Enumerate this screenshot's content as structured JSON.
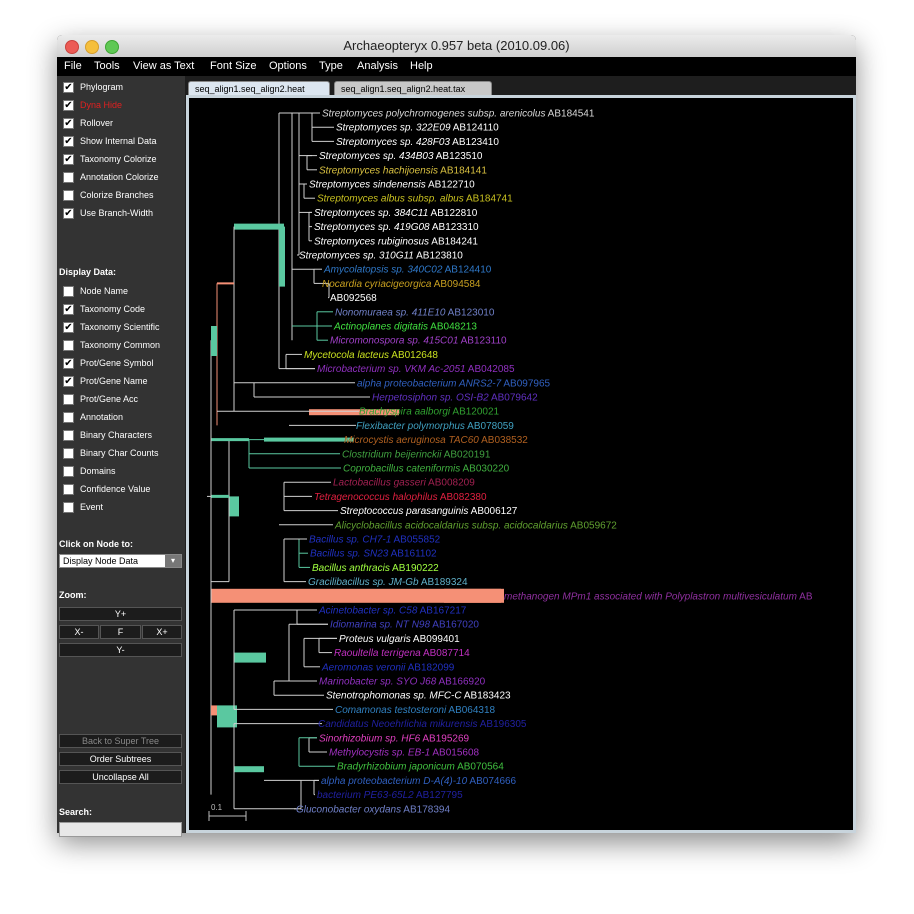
{
  "window": {
    "title": "Archaeopteryx 0.957 beta (2010.09.06)"
  },
  "menu": [
    "File",
    "Tools",
    "View as Text",
    "Font Size",
    "Options",
    "Type",
    "Analysis",
    "Help"
  ],
  "toggles": [
    {
      "label": "Phylogram",
      "checked": true,
      "color": "#ffffff"
    },
    {
      "label": "Dyna Hide",
      "checked": true,
      "color": "#e02020"
    },
    {
      "label": "Rollover",
      "checked": true,
      "color": "#ffffff"
    },
    {
      "label": "Show Internal Data",
      "checked": true,
      "color": "#ffffff"
    },
    {
      "label": "Taxonomy Colorize",
      "checked": true,
      "color": "#ffffff"
    },
    {
      "label": "Annotation Colorize",
      "checked": false,
      "color": "#ffffff"
    },
    {
      "label": "Colorize Branches",
      "checked": false,
      "color": "#ffffff"
    },
    {
      "label": "Use Branch-Width",
      "checked": true,
      "color": "#ffffff"
    }
  ],
  "display_data_header": "Display Data:",
  "display_data": [
    {
      "label": "Node Name",
      "checked": false
    },
    {
      "label": "Taxonomy Code",
      "checked": true
    },
    {
      "label": "Taxonomy Scientific",
      "checked": true
    },
    {
      "label": "Taxonomy Common",
      "checked": false
    },
    {
      "label": "Prot/Gene Symbol",
      "checked": true
    },
    {
      "label": "Prot/Gene Name",
      "checked": true
    },
    {
      "label": "Prot/Gene Acc",
      "checked": false
    },
    {
      "label": "Annotation",
      "checked": false
    },
    {
      "label": "Binary Characters",
      "checked": false
    },
    {
      "label": "Binary Char Counts",
      "checked": false
    },
    {
      "label": "Domains",
      "checked": false
    },
    {
      "label": "Confidence Value",
      "checked": false
    },
    {
      "label": "Event",
      "checked": false
    }
  ],
  "click_on_node": {
    "header": "Click on Node to:",
    "selected": "Display Node Data"
  },
  "zoom": {
    "header": "Zoom:",
    "y_plus": "Y+",
    "x_minus": "X-",
    "fit": "F",
    "x_plus": "X+",
    "y_minus": "Y-"
  },
  "buttons": {
    "back": "Back to Super Tree",
    "order": "Order Subtrees",
    "uncollapse": "Uncollapse All"
  },
  "search": {
    "header": "Search:",
    "value": ""
  },
  "tabs": [
    {
      "label": "seq_align1.seq_align2.heat",
      "active": true
    },
    {
      "label": "seq_align1.seq_align2.heat.tax",
      "active": false
    }
  ],
  "scale_label": "0.1",
  "leaves": [
    {
      "name": "Streptomyces polychromogenes subsp. arenicolus",
      "acc": "AB184541",
      "color": "#d8d8d8"
    },
    {
      "name": "Streptomyces sp. 322E09",
      "acc": "AB124110",
      "color": "#ffffff"
    },
    {
      "name": "Streptomyces sp. 428F03",
      "acc": "AB123410",
      "color": "#ffffff"
    },
    {
      "name": "Streptomyces sp. 434B03",
      "acc": "AB123510",
      "color": "#ffffff"
    },
    {
      "name": "Streptomyces hachijoensis",
      "acc": "AB184141",
      "color": "#d8c040"
    },
    {
      "name": "Streptomyces sindenensis",
      "acc": "AB122710",
      "color": "#ffffff"
    },
    {
      "name": "Streptomyces albus subsp. albus",
      "acc": "AB184741",
      "color": "#c8c020"
    },
    {
      "name": "Streptomyces sp. 384C11",
      "acc": "AB122810",
      "color": "#ffffff"
    },
    {
      "name": "Streptomyces sp. 419G08",
      "acc": "AB123310",
      "color": "#ffffff"
    },
    {
      "name": "Streptomyces rubiginosus",
      "acc": "AB184241",
      "color": "#ffffff"
    },
    {
      "name": "Streptomyces sp. 310G11",
      "acc": "AB123810",
      "color": "#ffffff"
    },
    {
      "name": "Amycolatopsis sp. 340C02",
      "acc": "AB124410",
      "color": "#2f78c8"
    },
    {
      "name": "Nocardia cyriacigeorgica",
      "acc": "AB094584",
      "color": "#c8a020"
    },
    {
      "name": "",
      "acc": "AB092568",
      "color": "#ffffff"
    },
    {
      "name": "Nonomuraea sp. 411E10",
      "acc": "AB123010",
      "color": "#7080c8"
    },
    {
      "name": "Actinoplanes digitatis",
      "acc": "AB048213",
      "color": "#40e040"
    },
    {
      "name": "Micromonospora sp. 415C01",
      "acc": "AB123110",
      "color": "#a040c8"
    },
    {
      "name": "Mycetocola lacteus",
      "acc": "AB012648",
      "color": "#c8e020"
    },
    {
      "name": "Microbacterium sp. VKM Ac-2051",
      "acc": "AB042085",
      "color": "#9030c0"
    },
    {
      "name": "alpha proteobacterium ANRS2-7",
      "acc": "AB097965",
      "color": "#3060c0"
    },
    {
      "name": "Herpetosiphon sp. OSI-B2",
      "acc": "AB079642",
      "color": "#6030c0"
    },
    {
      "name": "Brachyspira aalborgi",
      "acc": "AB120021",
      "color": "#30a030"
    },
    {
      "name": "Flexibacter polymorphus",
      "acc": "AB078059",
      "color": "#40a0c0"
    },
    {
      "name": "Microcystis aeruginosa TAC60",
      "acc": "AB038532",
      "color": "#b06020"
    },
    {
      "name": "Clostridium beijerinckii",
      "acc": "AB020191",
      "color": "#40a040"
    },
    {
      "name": "Coprobacillus cateniformis",
      "acc": "AB030220",
      "color": "#40b040"
    },
    {
      "name": "Lactobacillus gasseri",
      "acc": "AB008209",
      "color": "#a02050"
    },
    {
      "name": "Tetragenococcus halophilus",
      "acc": "AB082380",
      "color": "#e02040"
    },
    {
      "name": "Streptococcus parasanguinis",
      "acc": "AB006127",
      "color": "#ffffff"
    },
    {
      "name": "Alicyclobacillus acidocaldarius subsp. acidocaldarius",
      "acc": "AB059672",
      "color": "#60a030"
    },
    {
      "name": "Bacillus sp. CH7-1",
      "acc": "AB055852",
      "color": "#2030c0"
    },
    {
      "name": "Bacillus sp. SN23",
      "acc": "AB161102",
      "color": "#2030c0"
    },
    {
      "name": "Bacillus anthracis",
      "acc": "AB190222",
      "color": "#a0ff40"
    },
    {
      "name": "Gracilibacillus sp. JM-Gb",
      "acc": "AB189324",
      "color": "#60b0c8"
    },
    {
      "name": "methanogen MPm1 associated with Polyplastron multivesiculatum",
      "acc": "AB",
      "color": "#9030a0"
    },
    {
      "name": "Acinetobacter sp. C58",
      "acc": "AB167217",
      "color": "#2030c0"
    },
    {
      "name": "Idiomarina sp. NT N98",
      "acc": "AB167020",
      "color": "#4040c0"
    },
    {
      "name": "Proteus vulgaris",
      "acc": "AB099401",
      "color": "#ffffff"
    },
    {
      "name": "Raoultella terrigena",
      "acc": "AB087714",
      "color": "#c030c0"
    },
    {
      "name": "Aeromonas veronii",
      "acc": "AB182099",
      "color": "#2030c0"
    },
    {
      "name": "Marinobacter sp. SYO J68",
      "acc": "AB166920",
      "color": "#9030c0"
    },
    {
      "name": "Stenotrophomonas sp. MFC-C",
      "acc": "AB183423",
      "color": "#ffffff"
    },
    {
      "name": "Comamonas testosteroni",
      "acc": "AB064318",
      "color": "#3080c0"
    },
    {
      "name": "Candidatus Neoehrlichia mikurensis",
      "acc": "AB196305",
      "color": "#2020a0"
    },
    {
      "name": "Sinorhizobium sp. HF6",
      "acc": "AB195269",
      "color": "#e040c0"
    },
    {
      "name": "Methylocystis sp. EB-1",
      "acc": "AB015608",
      "color": "#a030c0"
    },
    {
      "name": "Bradyrhizobium japonicum",
      "acc": "AB070564",
      "color": "#40c040"
    },
    {
      "name": "alpha proteobacterium D-A(4)-10",
      "acc": "AB074666",
      "color": "#3060c0"
    },
    {
      "name": "bacterium PE63-65L2",
      "acc": "AB127795",
      "color": "#2020a0"
    },
    {
      "name": "Gluconobacter oxydans",
      "acc": "AB178394",
      "color": "#7080c8"
    }
  ]
}
